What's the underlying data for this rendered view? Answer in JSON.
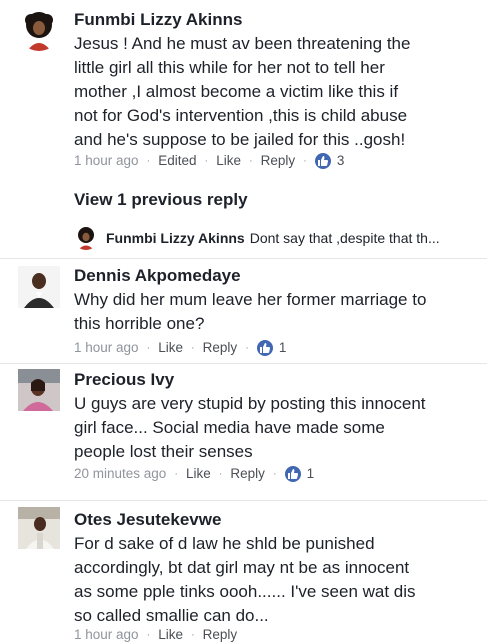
{
  "comments": [
    {
      "author": "Funmbi Lizzy Akinns",
      "text": "Jesus ! And he must av been threatening the\nlittle girl all this while for her not to tell her\nmother ,I almost become a victim like this if\nnot for God's intervention ,this is child abuse\nand he's suppose to be jailed for this ..gosh!",
      "time": "1 hour ago",
      "edited": "Edited",
      "like": "Like",
      "reply": "Reply",
      "likes_count": "3"
    },
    {
      "author": "Dennis Akpomedaye",
      "text": "Why did her mum leave her former marriage to\nthis horrible one?",
      "time": "1 hour ago",
      "like": "Like",
      "reply": "Reply",
      "likes_count": "1"
    },
    {
      "author": "Precious Ivy",
      "text": "U guys are very stupid by posting this innocent\ngirl face... Social media have made some\npeople lost their senses",
      "time": "20 minutes ago",
      "like": "Like",
      "reply": "Reply",
      "likes_count": "1"
    },
    {
      "author": "Otes Jesutekevwe",
      "text": "For d sake of d law he shld be punished\naccordingly, bt dat girl may nt be as innocent\nas some pple tinks oooh...... I've seen wat dis\nso called smallie can do...",
      "time": "1 hour ago",
      "like": "Like",
      "reply": "Reply"
    }
  ],
  "view_previous": "View 1 previous reply",
  "reply_preview": {
    "author": "Funmbi Lizzy Akinns",
    "text": "Dont say that ,despite that th..."
  },
  "separator": "·",
  "colors": {
    "like_badge": "#4267b2",
    "meta_text": "#90949c",
    "text": "#1d2129"
  }
}
